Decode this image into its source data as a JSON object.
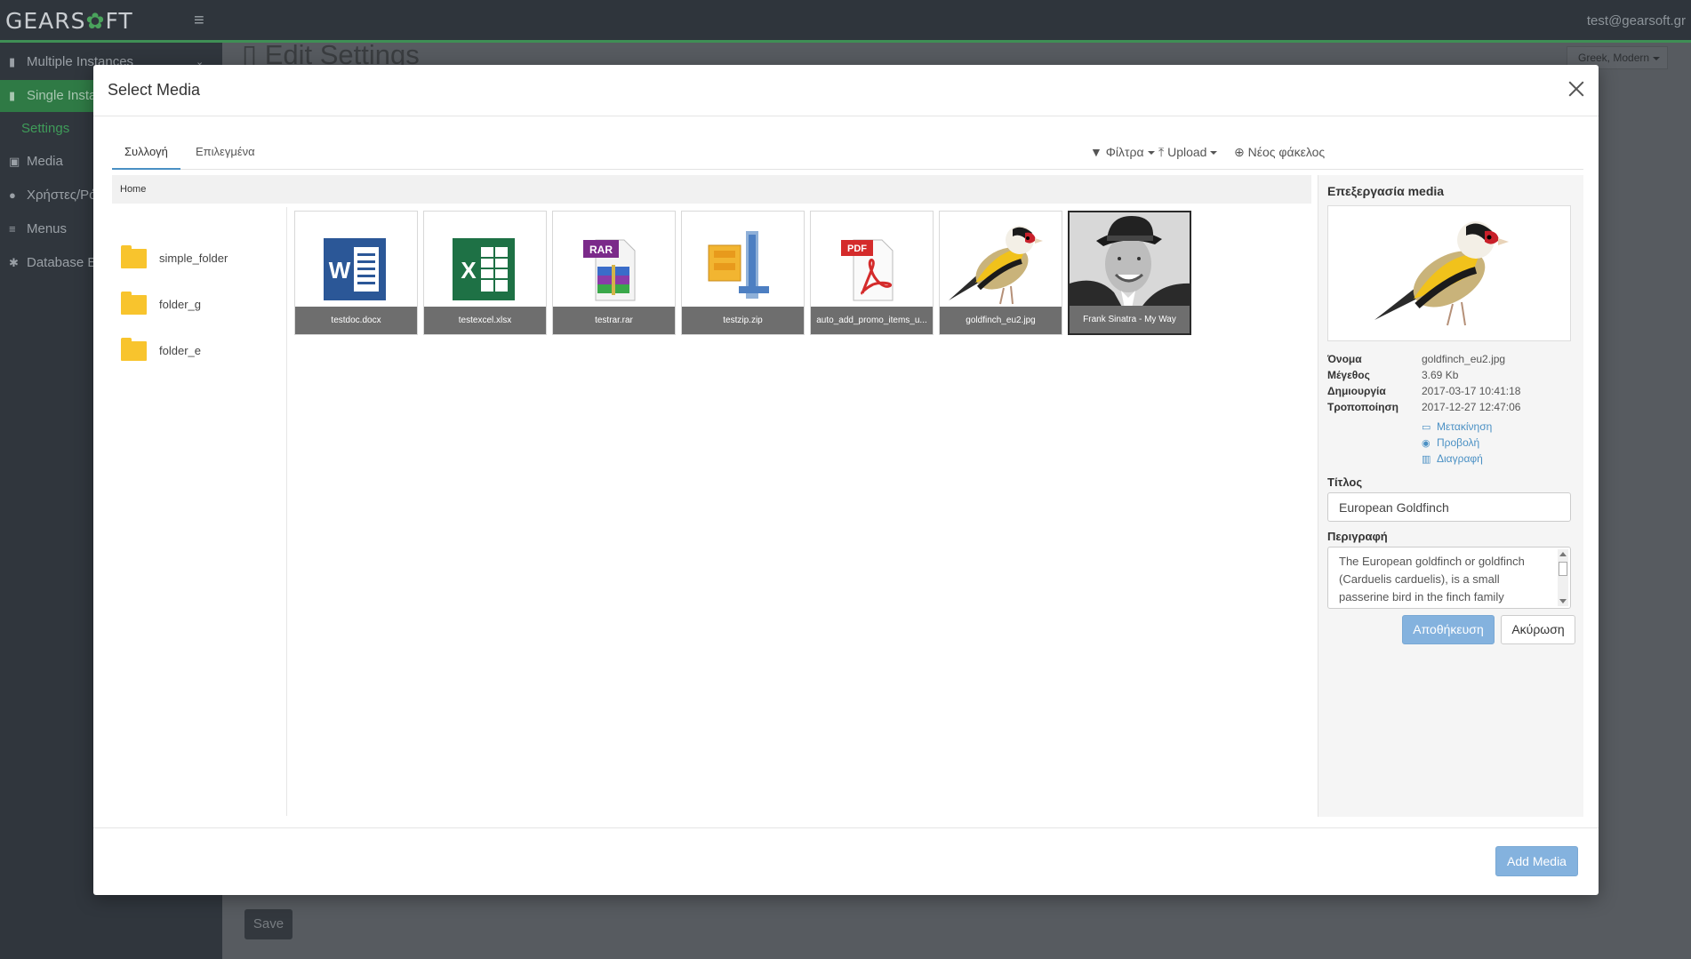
{
  "app": {
    "logo_part1": "GEARS",
    "logo_part2": "FT",
    "user_email": "test@gearsoft.gr",
    "page_title": "Edit Settings",
    "language_select": "Greek, Modern",
    "save_label": "Save"
  },
  "sidebar": {
    "items": [
      {
        "label": "Multiple Instances"
      },
      {
        "label": "Single Insta"
      },
      {
        "label": "Settings"
      },
      {
        "label": "Media"
      },
      {
        "label": "Χρήστες/Ρό"
      },
      {
        "label": "Menus"
      },
      {
        "label": "Database E"
      }
    ]
  },
  "modal": {
    "title": "Select Media",
    "tabs": [
      {
        "label": "Συλλογή",
        "active": true
      },
      {
        "label": "Επιλεγμένα",
        "active": false
      }
    ],
    "toolbar": {
      "filters_label": "Φίλτρα",
      "upload_label": "Upload",
      "new_folder_label": "Νέος φάκελος"
    },
    "breadcrumb": "Home",
    "folders": [
      {
        "name": "simple_folder"
      },
      {
        "name": "folder_g"
      },
      {
        "name": "folder_e"
      }
    ],
    "media": [
      {
        "name": "testdoc.docx",
        "icon": "word-icon",
        "type_label": "W"
      },
      {
        "name": "testexcel.xlsx",
        "icon": "excel-icon",
        "type_label": "X"
      },
      {
        "name": "testrar.rar",
        "icon": "rar-icon",
        "type_label": "RAR"
      },
      {
        "name": "testzip.zip",
        "icon": "zip-icon",
        "type_label": ""
      },
      {
        "name": "auto_add_promo_items_u...",
        "icon": "pdf-icon",
        "type_label": "PDF"
      },
      {
        "name": "goldfinch_eu2.jpg",
        "icon": "goldfinch-image",
        "type_label": ""
      },
      {
        "name": "Frank Sinatra - My Way",
        "icon": "portrait-image",
        "type_label": "",
        "selected": true
      }
    ],
    "add_media_label": "Add Media"
  },
  "edit_panel": {
    "title": "Επεξεργασία media",
    "meta": [
      {
        "label": "Όνομα",
        "value": "goldfinch_eu2.jpg"
      },
      {
        "label": "Μέγεθος",
        "value": "3.69 Kb"
      },
      {
        "label": "Δημιουργία",
        "value": "2017-03-17 10:41:18"
      },
      {
        "label": "Τροποποίηση",
        "value": "2017-12-27 12:47:06"
      }
    ],
    "actions": [
      {
        "label": "Μετακίνηση",
        "icon": "folder-outline-icon"
      },
      {
        "label": "Προβολή",
        "icon": "eye-icon"
      },
      {
        "label": "Διαγραφή",
        "icon": "trash-icon"
      }
    ],
    "title_label": "Τίτλος",
    "title_value": "European Goldfinch",
    "description_label": "Περιγραφή",
    "description_value": "The European goldfinch or goldfinch (Carduelis carduelis), is a small passerine bird in the finch family",
    "save_label": "Αποθήκευση",
    "cancel_label": "Ακύρωση"
  },
  "colors": {
    "accent": "#4a90c4",
    "primary_button": "#84b2de",
    "sidebar_active": "#2f7a45",
    "folder": "#f8c42d"
  }
}
